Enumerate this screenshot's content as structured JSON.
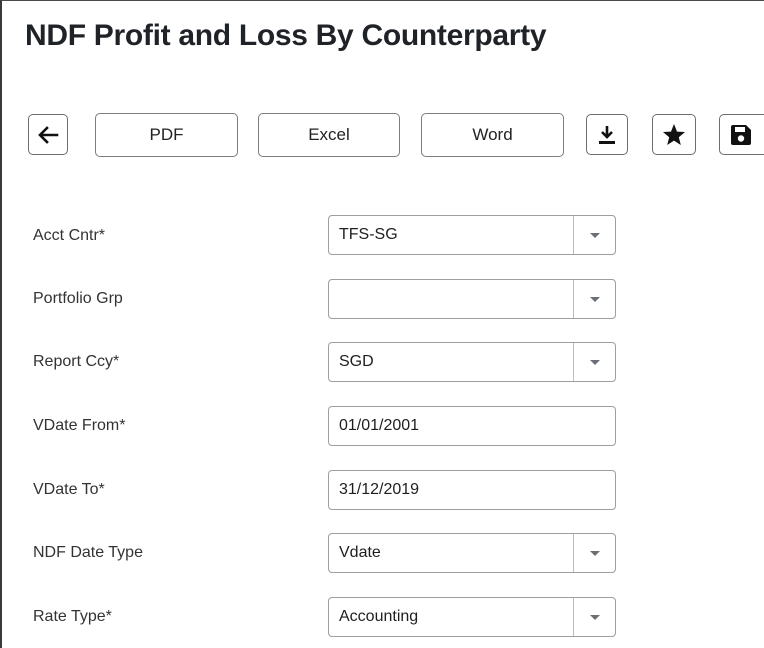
{
  "page": {
    "title": "NDF Profit and Loss By Counterparty"
  },
  "toolbar": {
    "back_icon": "arrow-left-icon",
    "pdf_label": "PDF",
    "excel_label": "Excel",
    "word_label": "Word",
    "download_icon": "download-icon",
    "favorite_icon": "star-icon",
    "save_icon": "floppy-disk-icon"
  },
  "form": {
    "acct_cntr": {
      "label": "Acct Cntr*",
      "value": "TFS-SG",
      "type": "select"
    },
    "portfolio_grp": {
      "label": "Portfolio Grp",
      "value": "",
      "type": "select"
    },
    "report_ccy": {
      "label": "Report Ccy*",
      "value": "SGD",
      "type": "select"
    },
    "vdate_from": {
      "label": "VDate From*",
      "value": "01/01/2001",
      "type": "text"
    },
    "vdate_to": {
      "label": "VDate To*",
      "value": "31/12/2019",
      "type": "text"
    },
    "ndf_date_type": {
      "label": "NDF Date Type",
      "value": "Vdate",
      "type": "select"
    },
    "rate_type": {
      "label": "Rate Type*",
      "value": "Accounting",
      "type": "select"
    }
  },
  "colors": {
    "text": "#1f2328",
    "border": "#9e9e9e",
    "caret": "#6a6f75"
  }
}
